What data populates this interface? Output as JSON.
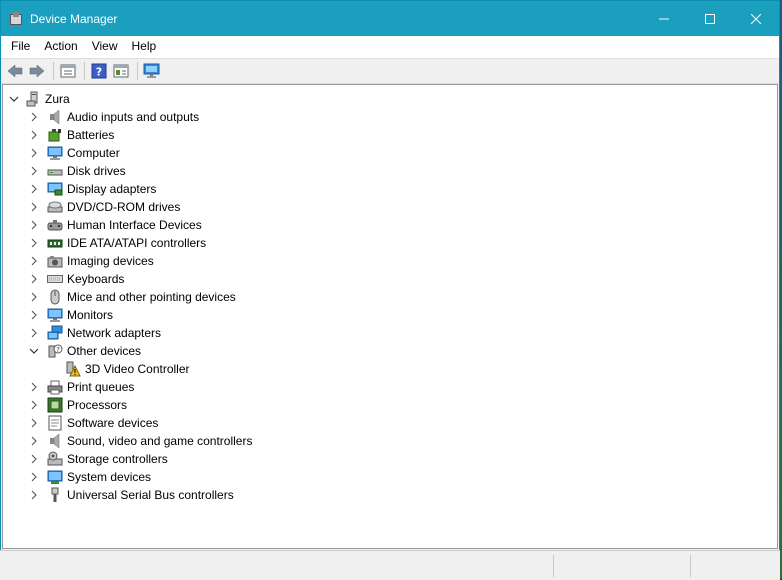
{
  "window": {
    "title": "Device Manager",
    "controls": [
      "minimize",
      "maximize",
      "close"
    ]
  },
  "menu": [
    "File",
    "Action",
    "View",
    "Help"
  ],
  "toolbar": {
    "buttons": [
      "back-arrow-icon",
      "forward-arrow-icon",
      "properties-icon",
      "help-icon",
      "details-pane-icon",
      "monitor-icon"
    ]
  },
  "tree": {
    "root": {
      "label": "Zura",
      "expanded": true,
      "icon": "computer-icon"
    },
    "categories": [
      {
        "label": "Audio inputs and outputs",
        "icon": "speaker-icon",
        "expanded": false
      },
      {
        "label": "Batteries",
        "icon": "battery-icon",
        "expanded": false
      },
      {
        "label": "Computer",
        "icon": "computer-icon",
        "expanded": false
      },
      {
        "label": "Disk drives",
        "icon": "disk-drive-icon",
        "expanded": false
      },
      {
        "label": "Display adapters",
        "icon": "display-adapter-icon",
        "expanded": false
      },
      {
        "label": "DVD/CD-ROM drives",
        "icon": "dvd-drive-icon",
        "expanded": false
      },
      {
        "label": "Human Interface Devices",
        "icon": "hid-icon",
        "expanded": false
      },
      {
        "label": "IDE ATA/ATAPI controllers",
        "icon": "ide-controller-icon",
        "expanded": false
      },
      {
        "label": "Imaging devices",
        "icon": "camera-icon",
        "expanded": false
      },
      {
        "label": "Keyboards",
        "icon": "keyboard-icon",
        "expanded": false
      },
      {
        "label": "Mice and other pointing devices",
        "icon": "mouse-icon",
        "expanded": false
      },
      {
        "label": "Monitors",
        "icon": "monitor-icon",
        "expanded": false
      },
      {
        "label": "Network adapters",
        "icon": "network-icon",
        "expanded": false
      },
      {
        "label": "Other devices",
        "icon": "unknown-device-icon",
        "expanded": true,
        "children": [
          {
            "label": "3D Video Controller",
            "icon": "warning-device-icon"
          }
        ]
      },
      {
        "label": "Print queues",
        "icon": "printer-icon",
        "expanded": false
      },
      {
        "label": "Processors",
        "icon": "processor-icon",
        "expanded": false
      },
      {
        "label": "Software devices",
        "icon": "software-device-icon",
        "expanded": false
      },
      {
        "label": "Sound, video and game controllers",
        "icon": "speaker-icon",
        "expanded": false
      },
      {
        "label": "Storage controllers",
        "icon": "storage-controller-icon",
        "expanded": false
      },
      {
        "label": "System devices",
        "icon": "system-device-icon",
        "expanded": false
      },
      {
        "label": "Universal Serial Bus controllers",
        "icon": "usb-icon",
        "expanded": false
      }
    ]
  },
  "colors": {
    "titlebar": "#1a9fbe",
    "background": "#f0f0f0",
    "tree_background": "#ffffff"
  }
}
